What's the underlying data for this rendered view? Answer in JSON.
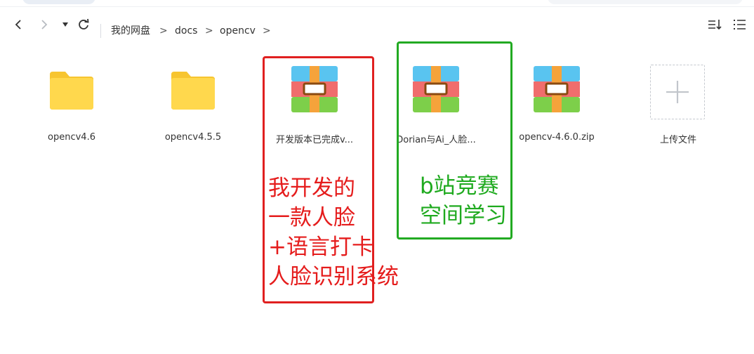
{
  "toolbar": {
    "breadcrumbs": [
      "我的网盘",
      "docs",
      "opencv"
    ],
    "separator": ">"
  },
  "files": [
    {
      "name": "opencv4.6",
      "type": "folder"
    },
    {
      "name": "opencv4.5.5",
      "type": "folder"
    },
    {
      "name": "开发版本已完成v...",
      "type": "archive"
    },
    {
      "name": "Dorian与Ai_人脸...",
      "type": "archive"
    },
    {
      "name": "opencv-4.6.0.zip",
      "type": "archive"
    }
  ],
  "upload": {
    "label": "上传文件"
  },
  "annotations": {
    "red": {
      "color": "#e51c1c",
      "lines": [
        "我开发的",
        "一款人脸",
        "+语言打卡",
        "人脸识别系统"
      ]
    },
    "green": {
      "color": "#1faa1f",
      "lines": [
        "b站竞赛",
        "空间学习"
      ]
    }
  },
  "icons": {
    "back": "chevron-left-icon",
    "forward": "chevron-right-icon",
    "history": "caret-down-icon",
    "refresh": "refresh-icon",
    "sort": "sort-icon",
    "view": "list-view-icon",
    "folder": "folder-icon",
    "archive": "archive-icon",
    "upload": "plus-icon"
  }
}
